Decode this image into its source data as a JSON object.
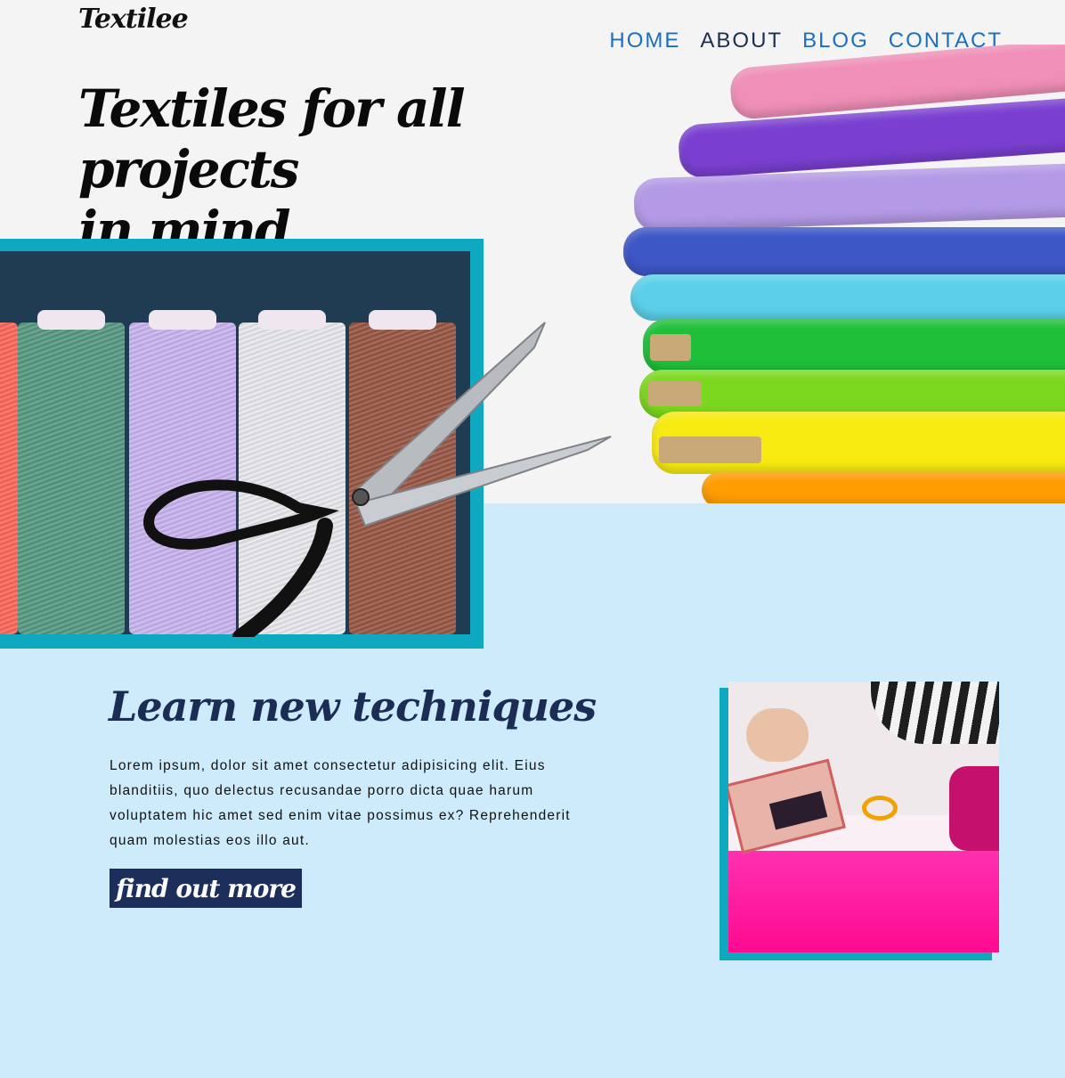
{
  "brand": {
    "logo_text": "Textilee"
  },
  "nav": {
    "items": [
      {
        "label": "HOME",
        "active": false
      },
      {
        "label": "ABOUT",
        "active": true
      },
      {
        "label": "BLOG",
        "active": false
      },
      {
        "label": "CONTACT",
        "active": false
      }
    ]
  },
  "hero": {
    "headline_line1": "Textiles for all projects",
    "headline_line2": "in mind",
    "fabric_colors": [
      "#f08fb8",
      "#7a3fd0",
      "#b49ae6",
      "#3d57c6",
      "#5cd0ea",
      "#1fbf3a",
      "#7bd81e",
      "#f7ea10",
      "#ffb400",
      "#ff5a1f"
    ]
  },
  "spools": {
    "colors": [
      "#ff6b5e",
      "#5a9c86",
      "#cbb6f2",
      "#e9e9ef",
      "#9b5a48"
    ]
  },
  "learn": {
    "title": "Learn new techniques",
    "body": "Lorem ipsum, dolor sit amet consectetur adipisicing elit. Eius blanditiis, quo delectus recusandae porro dicta quae harum voluptatem hic amet sed enim vitae possimus ex? Reprehenderit quam molestias eos illo aut.",
    "button_label": "find out more"
  },
  "colors": {
    "accent_teal": "#0ea8c1",
    "navy": "#1b2f5a",
    "light_blue_bg": "#cdebfb",
    "nav_link": "#1a6fc0"
  }
}
